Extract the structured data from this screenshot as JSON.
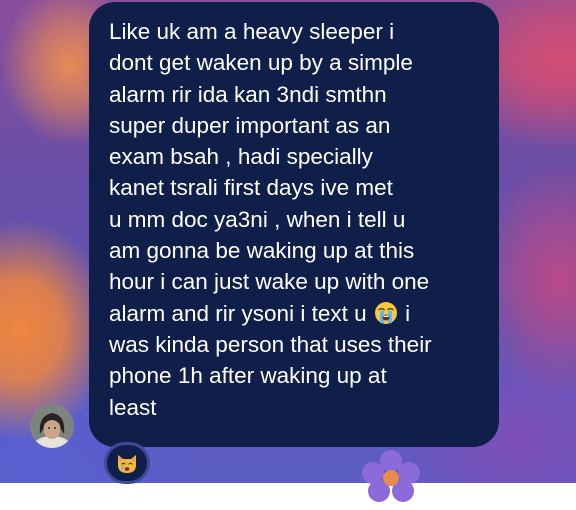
{
  "message": {
    "lines": [
      "Like uk am a heavy sleeper i",
      "dont get waken up by a simple",
      "alarm rir ida kan 3ndi smthn",
      "super duper important as an",
      "exam bsah , hadi specially",
      "kanet tsrali first days ive met",
      "u mm doc ya3ni , when i tell u",
      "am gonna be waking up at this",
      "hour i can just wake up with one",
      "alarm and rir ysoni i text u",
      "i",
      "was kinda person that uses their",
      "phone 1h after waking up at",
      "least"
    ],
    "inline_emoji": "loudly-crying-face-icon"
  },
  "reaction": {
    "emoji": "crying-cat-face-icon"
  },
  "colors": {
    "bubble": "#0f1f4a",
    "text": "#ffffff",
    "reaction_border": "#3f4a9a"
  }
}
